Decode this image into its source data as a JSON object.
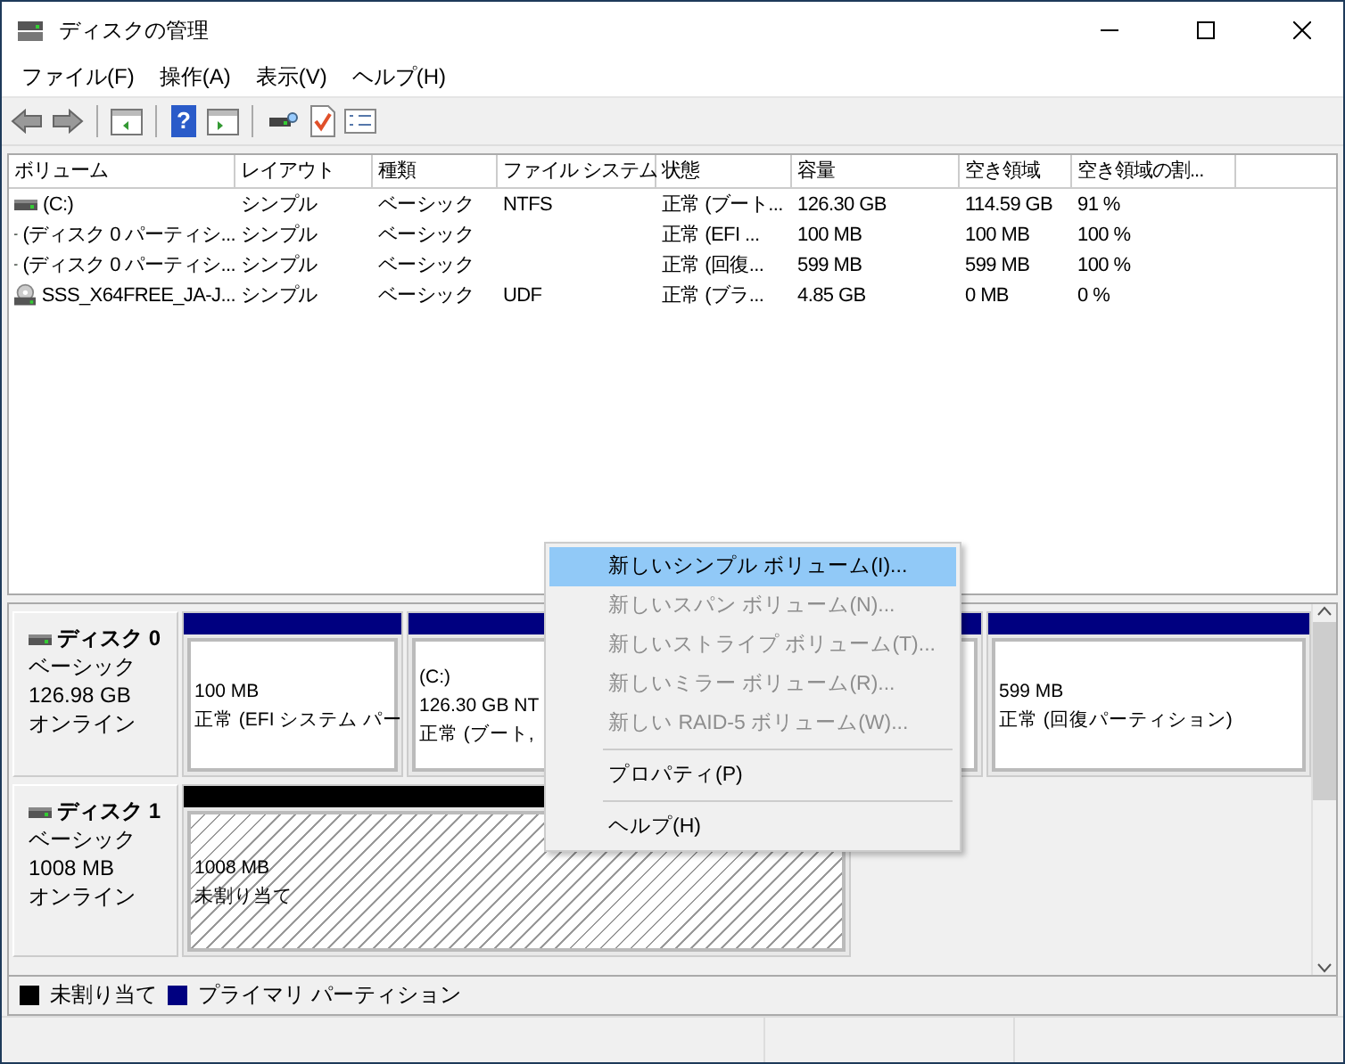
{
  "window": {
    "title": "ディスクの管理"
  },
  "menu_bar": [
    "ファイル(F)",
    "操作(A)",
    "表示(V)",
    "ヘルプ(H)"
  ],
  "toolbar": {
    "help_glyph": "?"
  },
  "volume_table": {
    "columns": [
      "ボリューム",
      "レイアウト",
      "種類",
      "ファイル システム",
      "状態",
      "容量",
      "空き領域",
      "空き領域の割..."
    ],
    "rows": [
      {
        "kind": "drive",
        "cells": [
          "(C:)",
          "シンプル",
          "ベーシック",
          "NTFS",
          "正常 (ブート...",
          "126.30 GB",
          "114.59 GB",
          "91 %"
        ]
      },
      {
        "kind": "drive",
        "cells": [
          "(ディスク 0 パーティシ...",
          "シンプル",
          "ベーシック",
          "",
          "正常 (EFI ...",
          "100 MB",
          "100 MB",
          "100 %"
        ]
      },
      {
        "kind": "drive",
        "cells": [
          "(ディスク 0 パーティシ...",
          "シンプル",
          "ベーシック",
          "",
          "正常 (回復...",
          "599 MB",
          "599 MB",
          "100 %"
        ]
      },
      {
        "kind": "disc",
        "cells": [
          "SSS_X64FREE_JA-J...",
          "シンプル",
          "ベーシック",
          "UDF",
          "正常 (ブラ...",
          "4.85 GB",
          "0 MB",
          "0 %"
        ]
      }
    ]
  },
  "disks": [
    {
      "name": "ディスク 0",
      "type": "ベーシック",
      "size": "126.98 GB",
      "status": "オンライン",
      "partitions": [
        {
          "kind": "primary",
          "lines": [
            "100 MB",
            "正常 (EFI システム パー"
          ]
        },
        {
          "kind": "primary",
          "label": "(C:)",
          "lines": [
            "126.30 GB NT",
            "正常 (ブート,"
          ]
        },
        {
          "kind": "primary",
          "lines": [
            "599 MB",
            "正常 (回復パーティション)"
          ]
        }
      ]
    },
    {
      "name": "ディスク 1",
      "type": "ベーシック",
      "size": "1008 MB",
      "status": "オンライン",
      "partitions": [
        {
          "kind": "unallocated",
          "lines": [
            "1008 MB",
            "未割り当て"
          ]
        }
      ]
    }
  ],
  "legend": [
    {
      "label": "未割り当て",
      "color": "#000000"
    },
    {
      "label": "プライマリ パーティション",
      "color": "#000080"
    }
  ],
  "context_menu": [
    {
      "kind": "item",
      "label": "新しいシンプル ボリューム(I)...",
      "selected": true,
      "disabled": false
    },
    {
      "kind": "item",
      "label": "新しいスパン ボリューム(N)...",
      "selected": false,
      "disabled": true
    },
    {
      "kind": "item",
      "label": "新しいストライプ ボリューム(T)...",
      "selected": false,
      "disabled": true
    },
    {
      "kind": "item",
      "label": "新しいミラー ボリューム(R)...",
      "selected": false,
      "disabled": true
    },
    {
      "kind": "item",
      "label": "新しい RAID-5 ボリューム(W)...",
      "selected": false,
      "disabled": true
    },
    {
      "kind": "separator"
    },
    {
      "kind": "item",
      "label": "プロパティ(P)",
      "selected": false,
      "disabled": false
    },
    {
      "kind": "separator"
    },
    {
      "kind": "item",
      "label": "ヘルプ(H)",
      "selected": false,
      "disabled": false
    }
  ]
}
